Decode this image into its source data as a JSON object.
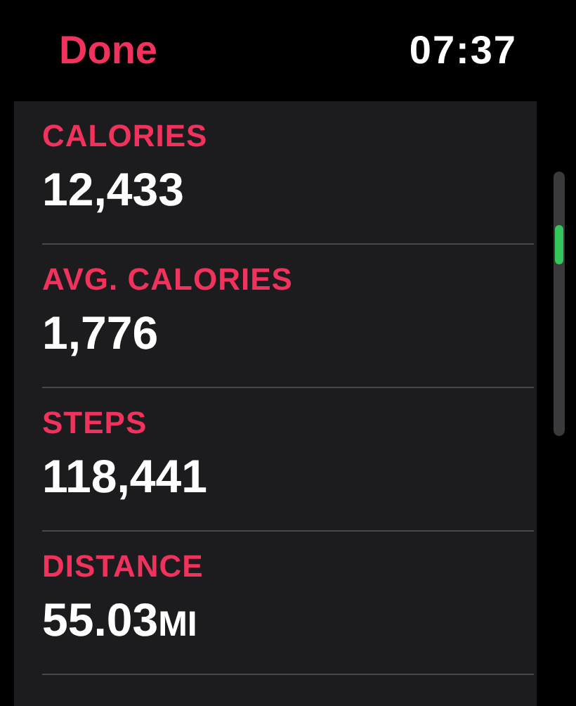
{
  "header": {
    "back_button": "Done",
    "time": "07:37"
  },
  "metrics": [
    {
      "label": "CALORIES",
      "value": "12,433"
    },
    {
      "label": "AVG. CALORIES",
      "value": "1,776"
    },
    {
      "label": "STEPS",
      "value": "118,441"
    },
    {
      "label": "DISTANCE",
      "value": "55.03",
      "unit": "MI"
    }
  ]
}
